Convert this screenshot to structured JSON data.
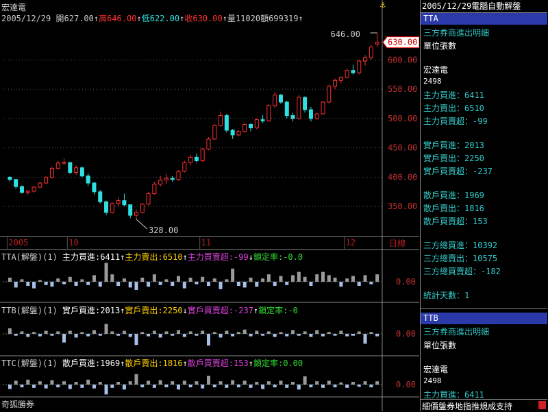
{
  "stock": {
    "name": "宏達電",
    "date": "2005/12/29",
    "open_label": "開",
    "open": "627.00",
    "high_label": "高",
    "high": "646.00",
    "low_label": "低",
    "low": "622.00",
    "close_label": "收",
    "close": "630.00",
    "vol_label": "量",
    "vol": "11020",
    "amt_label": "額",
    "amt": "699319",
    "arrow": "↑"
  },
  "colors": {
    "up": "#ff3030",
    "down": "#30e0e0",
    "grid": "#555",
    "pos_bar": "#9a9a9a",
    "neg_bar": "#a8c0e8"
  },
  "chart_data": {
    "type": "candlestick",
    "ylim": [
      300,
      660
    ],
    "yticks": [
      "350.00",
      "400.00",
      "450.00",
      "500.00",
      "550.00",
      "600.00"
    ],
    "max_label": "646.00",
    "min_label": "328.00",
    "last_label": "630.00",
    "x_labels": [
      {
        "text": "2005",
        "i": 0
      },
      {
        "text": "10",
        "i": 10
      },
      {
        "text": "11",
        "i": 32
      },
      {
        "text": "12",
        "i": 56
      }
    ],
    "period_label": "日線",
    "candles": [
      [
        400,
        402,
        393,
        396
      ],
      [
        396,
        397,
        380,
        384
      ],
      [
        384,
        386,
        372,
        374
      ],
      [
        374,
        378,
        370,
        376
      ],
      [
        376,
        385,
        373,
        383
      ],
      [
        383,
        392,
        381,
        390
      ],
      [
        390,
        402,
        389,
        400
      ],
      [
        400,
        418,
        398,
        415
      ],
      [
        415,
        428,
        413,
        424
      ],
      [
        424,
        432,
        421,
        425
      ],
      [
        425,
        424,
        405,
        408
      ],
      [
        408,
        420,
        404,
        416
      ],
      [
        416,
        418,
        400,
        402
      ],
      [
        402,
        407,
        385,
        390
      ],
      [
        390,
        392,
        370,
        375
      ],
      [
        375,
        378,
        355,
        358
      ],
      [
        358,
        360,
        335,
        340
      ],
      [
        340,
        358,
        338,
        355
      ],
      [
        355,
        365,
        350,
        360
      ],
      [
        360,
        372,
        350,
        353
      ],
      [
        353,
        352,
        330,
        335
      ],
      [
        335,
        345,
        328,
        340
      ],
      [
        340,
        356,
        338,
        354
      ],
      [
        354,
        375,
        352,
        372
      ],
      [
        372,
        392,
        370,
        388
      ],
      [
        388,
        402,
        384,
        395
      ],
      [
        395,
        405,
        389,
        398
      ],
      [
        398,
        402,
        392,
        396
      ],
      [
        396,
        412,
        394,
        410
      ],
      [
        410,
        428,
        408,
        425
      ],
      [
        425,
        438,
        420,
        434
      ],
      [
        434,
        440,
        425,
        428
      ],
      [
        428,
        450,
        426,
        448
      ],
      [
        448,
        468,
        446,
        465
      ],
      [
        465,
        490,
        463,
        488
      ],
      [
        488,
        512,
        486,
        505
      ],
      [
        505,
        508,
        476,
        480
      ],
      [
        480,
        482,
        465,
        472
      ],
      [
        472,
        480,
        470,
        478
      ],
      [
        478,
        493,
        476,
        490
      ],
      [
        490,
        492,
        478,
        484
      ],
      [
        484,
        500,
        482,
        498
      ],
      [
        498,
        506,
        492,
        496
      ],
      [
        496,
        525,
        494,
        522
      ],
      [
        522,
        545,
        518,
        540
      ],
      [
        540,
        542,
        525,
        528
      ],
      [
        528,
        530,
        500,
        505
      ],
      [
        505,
        510,
        495,
        500
      ],
      [
        500,
        540,
        498,
        536
      ],
      [
        536,
        538,
        510,
        515
      ],
      [
        515,
        520,
        495,
        500
      ],
      [
        500,
        510,
        498,
        508
      ],
      [
        508,
        530,
        506,
        528
      ],
      [
        528,
        558,
        526,
        555
      ],
      [
        555,
        568,
        550,
        565
      ],
      [
        565,
        572,
        560,
        570
      ],
      [
        570,
        585,
        568,
        582
      ],
      [
        582,
        592,
        575,
        578
      ],
      [
        578,
        600,
        575,
        598
      ],
      [
        598,
        608,
        590,
        604
      ],
      [
        604,
        625,
        600,
        622
      ],
      [
        627,
        646,
        622,
        630
      ]
    ],
    "tta": [
      0.5,
      -0.7,
      0.3,
      -0.5,
      -0.8,
      0.2,
      -0.4,
      -0.6,
      0.4,
      -0.3,
      0.6,
      -0.5,
      0.3,
      -0.4,
      0.8,
      -0.6,
      2.3,
      0.9,
      -0.5,
      0.4,
      -0.7,
      -1.0,
      0.5,
      -0.6,
      0.9,
      -0.4,
      0.3,
      -0.5,
      0.7,
      -0.8,
      0.5,
      -0.3,
      0.6,
      -0.5,
      0.4,
      -0.9,
      0.3,
      1.6,
      -0.5,
      -0.7,
      0.5,
      -0.6,
      0.4,
      0.9,
      -0.5,
      0.7,
      -0.4,
      0.8,
      1.2,
      0.6,
      -0.5,
      0.9,
      1.2,
      0.8,
      0.5,
      -0.6,
      0.4,
      0.7,
      -0.5,
      0.8,
      -0.3,
      0.9
    ],
    "ttb": [
      0.9,
      -0.3,
      0.4,
      -0.5,
      0.3,
      -0.4,
      0.5,
      -0.3,
      0.4,
      -1.4,
      0.5,
      -0.6,
      0.3,
      -0.4,
      0.6,
      -0.3,
      1.6,
      0.4,
      -0.3,
      0.5,
      -0.5,
      -1.8,
      0.3,
      -0.4,
      0.5,
      -0.6,
      0.4,
      -0.3,
      0.6,
      -0.5,
      0.4,
      -0.3,
      0.5,
      -1.9,
      0.3,
      -0.6,
      0.5,
      -0.4,
      0.3,
      0.7,
      -0.4,
      0.5,
      -0.3,
      0.4,
      -0.5,
      0.3,
      -0.4,
      0.6,
      -0.3,
      0.4,
      -0.5,
      0.6,
      -0.4,
      0.3,
      -0.3,
      0.5,
      -0.4,
      -0.3,
      0.4,
      -1.6,
      0.3,
      -0.4
    ],
    "ttc": [
      -0.8,
      0.7,
      -0.5,
      0.9,
      -0.6,
      0.6,
      -0.7,
      0.8,
      -0.5,
      0.6,
      -0.8,
      0.5,
      -0.6,
      0.9,
      -0.7,
      0.5,
      -1.8,
      -0.6,
      0.5,
      -0.9,
      0.6,
      1.9,
      -0.5,
      0.7,
      -0.6,
      0.8,
      -0.5,
      0.6,
      -0.9,
      0.7,
      -0.5,
      0.6,
      -0.7,
      1.6,
      -0.5,
      0.6,
      -0.6,
      0.8,
      -0.5,
      0.7,
      -0.6,
      0.5,
      -0.8,
      0.6,
      -0.5,
      0.7,
      -0.6,
      0.5,
      -0.9,
      1.5,
      -0.5,
      0.6,
      -0.6,
      0.7,
      -0.5,
      0.4,
      -0.6,
      0.5,
      -0.4,
      0.6,
      -0.5,
      0.6
    ]
  },
  "indicators": {
    "tta": {
      "title": "TTA(解盤)(1)",
      "a_label": "主力買進:",
      "a_val": "6411",
      "b_label": "主力賣出:",
      "b_val": "6510",
      "c_label": "主力買賣超:",
      "c_val": "-99",
      "d_label": "鎖定率:",
      "d_val": "-0.0",
      "zero": "0.00"
    },
    "ttb": {
      "title": "TTB(解盤)(1)",
      "a_label": "實戶買進:",
      "a_val": "2013",
      "b_label": "實戶賣出:",
      "b_val": "2250",
      "c_label": "實戶買賣超:",
      "c_val": "-237",
      "d_label": "鎖定率:",
      "d_val": "-0",
      "zero": "0.00"
    },
    "ttc": {
      "title": "TTC(解盤)(1)",
      "a_label": "散戶買進:",
      "a_val": "1969",
      "b_label": "散戶賣出:",
      "b_val": "1816",
      "c_label": "散戶買賣超:",
      "c_val": "153",
      "d_label": "鎖定率:",
      "d_val": "0.00",
      "zero": "0.00"
    }
  },
  "footer": {
    "brand": "奇狐勝券"
  },
  "panel": {
    "date": "2005/12/29",
    "title": "電腦自動解盤",
    "tta": {
      "tab": "TTA",
      "line1": "三方券商進出明細",
      "line2": "單位張數",
      "name": "宏達電",
      "code": "2498",
      "r1": "主力買進：6411",
      "r2": "主力賣出：6510",
      "r3": "主力買賣超：-99",
      "r4": "實戶買進：2013",
      "r5": "實戶賣出：2250",
      "r6": "實戶買賣超：-237",
      "r7": "散戶買進：1969",
      "r8": "散戶賣出：1816",
      "r9": "散戶買賣超：153",
      "r10": "三方總買進：10392",
      "r11": "三方總賣出：10575",
      "r12": "三方總買賣超：-182",
      "r13": "統計天數：1"
    },
    "ttb": {
      "tab": "TTB",
      "line1": "三方券商進出明細",
      "line2": "單位張數",
      "name": "宏達電",
      "code": "2498",
      "r1": "主力買進：6411"
    },
    "status": "細價盤券地指推規成支持"
  }
}
